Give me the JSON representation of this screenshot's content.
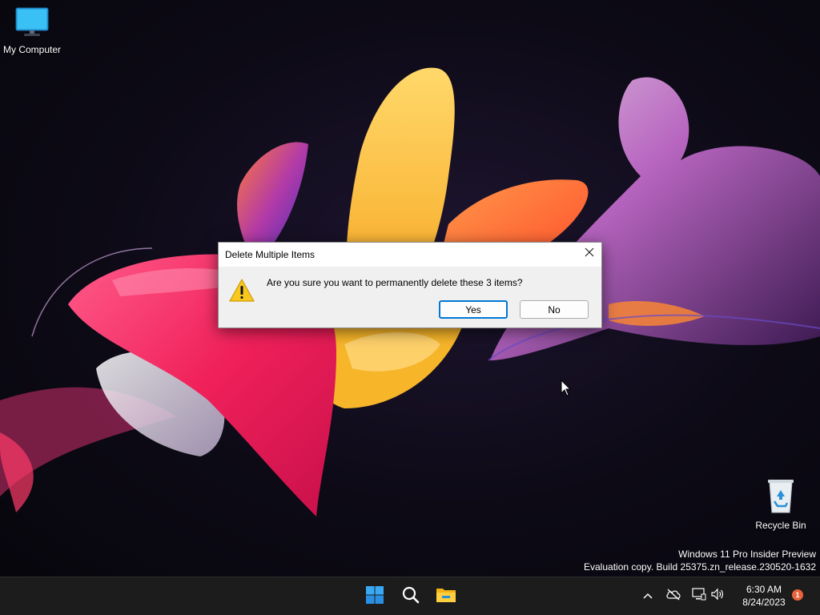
{
  "desktop": {
    "icons": [
      {
        "label": "My Computer",
        "icon": "monitor-icon"
      },
      {
        "label": "Recycle Bin",
        "icon": "recycle-bin-icon"
      }
    ],
    "watermark": {
      "line1": "Windows 11 Pro Insider Preview",
      "line2": "Evaluation copy. Build 25375.zn_release.230520-1632"
    }
  },
  "dialog": {
    "title": "Delete Multiple Items",
    "message": "Are you sure you want to permanently delete these 3 items?",
    "icon": "warning-icon",
    "yes_label": "Yes",
    "no_label": "No",
    "close_icon": "close-icon"
  },
  "taskbar": {
    "pinned": [
      {
        "name": "Start",
        "icon": "windows-logo-icon"
      },
      {
        "name": "Search",
        "icon": "search-icon"
      },
      {
        "name": "File Explorer",
        "icon": "folder-icon"
      }
    ],
    "tray_icons": [
      "chevron-up-icon",
      "cloud-off-icon",
      "network-icon",
      "volume-icon"
    ],
    "clock": {
      "time": "6:30 AM",
      "date": "8/24/2023"
    },
    "notification_count": "1"
  },
  "colors": {
    "accent": "#0078d4",
    "taskbar_bg": "#1c1c1c",
    "dialog_bg": "#f0f0f0",
    "badge": "#e8633a"
  }
}
